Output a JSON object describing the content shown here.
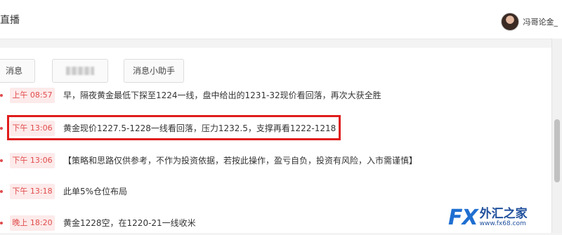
{
  "header": {
    "title": "直播",
    "user_name": "冯哥论金_"
  },
  "tabs": [
    {
      "label": "消息"
    },
    {
      "label": ""
    },
    {
      "label": "消息小助手"
    }
  ],
  "messages": [
    {
      "time": "上午 08:57",
      "text": "早，隔夜黄金最低下探至1224一线，盘中给出的1231-32现价看回落，再次大获全胜"
    },
    {
      "time": "下午 13:06",
      "text": "黄金现价1227.5-1228一线看回落，压力1232.5，支撑再看1222-1218"
    },
    {
      "time": "下午 13:06",
      "text": "【策略和思路仅供参考，不作为投资依据，若按此操作，盈亏自负，投资有风险，入市需谨慎】"
    },
    {
      "time": "下午 13:18",
      "text": "此单5%仓位布局"
    },
    {
      "time": "晚上 18:20",
      "text": "黄金1228空，在1220-21一线收米"
    }
  ],
  "watermark": {
    "brand": "FX",
    "brand_cn": "外汇之家",
    "url": "www.fx68.com"
  },
  "colors": {
    "accent_red": "#e04b4b",
    "highlight_border": "#e01c1c",
    "time_badge_bg": "#fdeaea",
    "watermark_blue": "#1f6fd1"
  }
}
